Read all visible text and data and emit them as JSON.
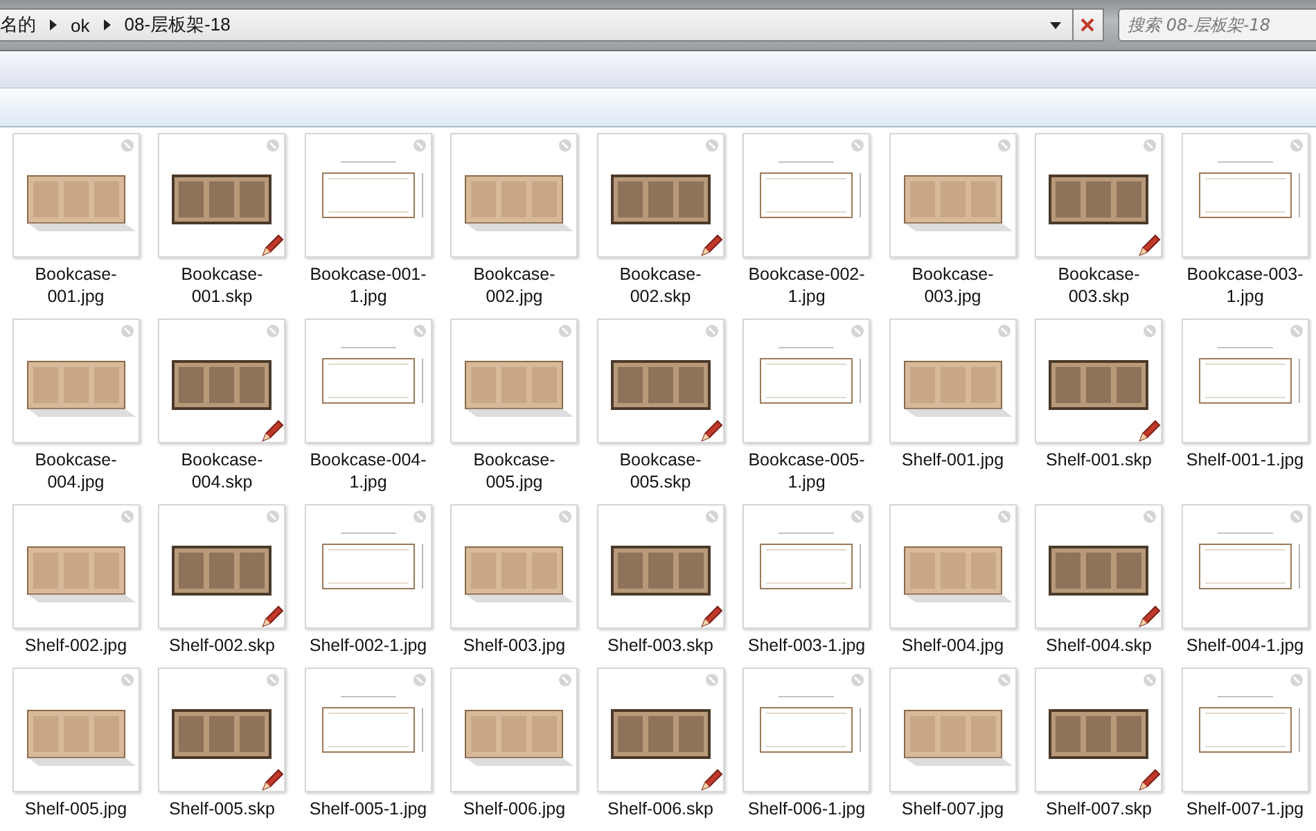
{
  "address_bar": {
    "breadcrumbs": [
      "名的",
      "ok",
      "08-层板架-18"
    ]
  },
  "search": {
    "placeholder": "搜索 08-层板架-18"
  },
  "items": [
    {
      "label": "Bookcase-001.jpg",
      "kind": "render"
    },
    {
      "label": "Bookcase-001.skp",
      "kind": "model"
    },
    {
      "label": "Bookcase-001-1.jpg",
      "kind": "drawing"
    },
    {
      "label": "Bookcase-002.jpg",
      "kind": "render"
    },
    {
      "label": "Bookcase-002.skp",
      "kind": "model"
    },
    {
      "label": "Bookcase-002-1.jpg",
      "kind": "drawing"
    },
    {
      "label": "Bookcase-003.jpg",
      "kind": "render"
    },
    {
      "label": "Bookcase-003.skp",
      "kind": "model"
    },
    {
      "label": "Bookcase-003-1.jpg",
      "kind": "drawing"
    },
    {
      "label": "Bookcase-004.jpg",
      "kind": "render"
    },
    {
      "label": "Bookcase-004.skp",
      "kind": "model"
    },
    {
      "label": "Bookcase-004-1.jpg",
      "kind": "drawing"
    },
    {
      "label": "Bookcase-005.jpg",
      "kind": "render"
    },
    {
      "label": "Bookcase-005.skp",
      "kind": "model"
    },
    {
      "label": "Bookcase-005-1.jpg",
      "kind": "drawing"
    },
    {
      "label": "Shelf-001.jpg",
      "kind": "render"
    },
    {
      "label": "Shelf-001.skp",
      "kind": "model"
    },
    {
      "label": "Shelf-001-1.jpg",
      "kind": "drawing"
    },
    {
      "label": "Shelf-002.jpg",
      "kind": "render"
    },
    {
      "label": "Shelf-002.skp",
      "kind": "model"
    },
    {
      "label": "Shelf-002-1.jpg",
      "kind": "drawing"
    },
    {
      "label": "Shelf-003.jpg",
      "kind": "render"
    },
    {
      "label": "Shelf-003.skp",
      "kind": "model"
    },
    {
      "label": "Shelf-003-1.jpg",
      "kind": "drawing"
    },
    {
      "label": "Shelf-004.jpg",
      "kind": "render"
    },
    {
      "label": "Shelf-004.skp",
      "kind": "model"
    },
    {
      "label": "Shelf-004-1.jpg",
      "kind": "drawing"
    },
    {
      "label": "Shelf-005.jpg",
      "kind": "render"
    },
    {
      "label": "Shelf-005.skp",
      "kind": "model"
    },
    {
      "label": "Shelf-005-1.jpg",
      "kind": "drawing"
    },
    {
      "label": "Shelf-006.jpg",
      "kind": "render"
    },
    {
      "label": "Shelf-006.skp",
      "kind": "model"
    },
    {
      "label": "Shelf-006-1.jpg",
      "kind": "drawing"
    },
    {
      "label": "Shelf-007.jpg",
      "kind": "render"
    },
    {
      "label": "Shelf-007.skp",
      "kind": "model"
    },
    {
      "label": "Shelf-007-1.jpg",
      "kind": "drawing"
    }
  ]
}
